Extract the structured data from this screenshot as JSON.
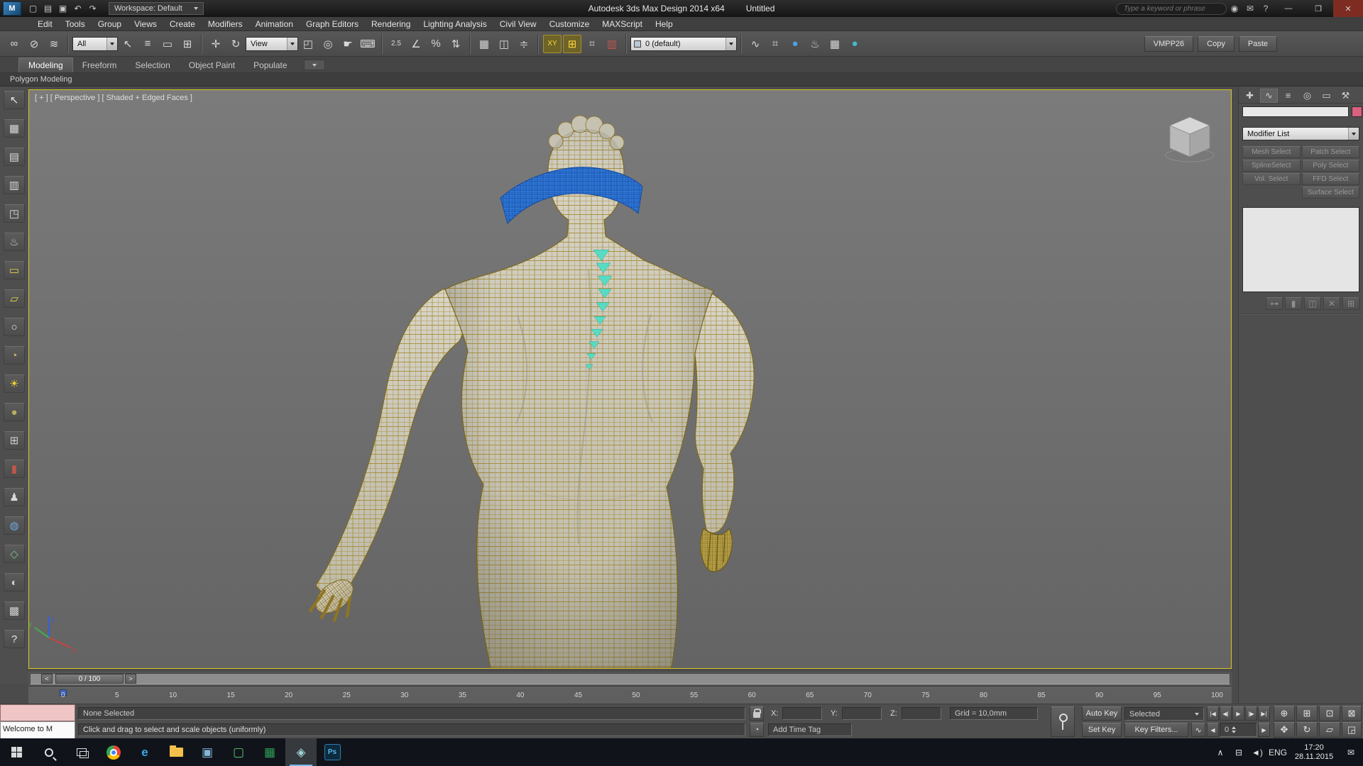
{
  "theme": {
    "viewport_border": "#d9c422",
    "selection_blue": "#2e79d8",
    "soft_selection_teal": "#5adfc6",
    "wireframe_yellow": "#a3882e",
    "accent_yellow": "#ffd43c"
  },
  "titlebar": {
    "logo_text": "M",
    "quick_icons": [
      "▢",
      "▤",
      "▣",
      "↶",
      "↷"
    ],
    "workspace_label": "Workspace: Default",
    "title": "Autodesk 3ds Max Design 2014 x64",
    "document": "Untitled",
    "search_placeholder": "Type a keyword or phrase",
    "help_icons": [
      "◉",
      "✉",
      "?"
    ],
    "window_buttons": [
      "—",
      "❐",
      "✕"
    ]
  },
  "menus": [
    "Edit",
    "Tools",
    "Group",
    "Views",
    "Create",
    "Modifiers",
    "Animation",
    "Graph Editors",
    "Rendering",
    "Lighting Analysis",
    "Civil View",
    "Customize",
    "MAXScript",
    "Help"
  ],
  "toolbar": {
    "link_icons": [
      "∞",
      "⊘",
      "≋"
    ],
    "filter_value": "All",
    "select_icons": [
      "↖",
      "≡",
      "▭",
      "⊞"
    ],
    "transform_icons": [
      "✛",
      "↻",
      "◰"
    ],
    "coord_value": "View",
    "pivot_icons": [
      "◎",
      "☛",
      "⌨"
    ],
    "snap_icons": [
      "2.5",
      "∠",
      "%",
      "⇅"
    ],
    "sel_set_icon": "▦",
    "mirror_icon": "◫",
    "align_icon": "≑",
    "constraint_label": "XY",
    "grid_icon": "⊞",
    "extra_icons": [
      "⌗",
      "▥"
    ],
    "layer_value": "0 (default)",
    "editor_icons": [
      "∿",
      "⌗",
      "●",
      "♨",
      "▦",
      "●"
    ],
    "buttons": [
      "VMPP26",
      "Copy",
      "Paste"
    ]
  },
  "ribbon": {
    "tabs": [
      "Modeling",
      "Freeform",
      "Selection",
      "Object Paint",
      "Populate"
    ],
    "panel": "Polygon Modeling"
  },
  "lefttools": {
    "icons": [
      {
        "g": "↖",
        "c": "#e8e8e8"
      },
      {
        "g": "▦",
        "c": "#d8d8d8"
      },
      {
        "g": "▤",
        "c": "#d8d8d8"
      },
      {
        "g": "▥",
        "c": "#d8d8d8"
      },
      {
        "g": "◳",
        "c": "#d8d8d8"
      },
      {
        "g": "♨",
        "c": "#cccccc"
      },
      {
        "g": "▭",
        "c": "#e7d24a"
      },
      {
        "g": "▱",
        "c": "#e7d24a"
      },
      {
        "g": "○",
        "c": "#e0e0e0"
      },
      {
        "g": "◔",
        "c": "#d8b86a"
      },
      {
        "g": "☀",
        "c": "#f2d431"
      },
      {
        "g": "●",
        "c": "#b9ad5f"
      },
      {
        "g": "⊞",
        "c": "#cfcfcf"
      },
      {
        "g": "▮",
        "c": "#c2564a"
      },
      {
        "g": "♟",
        "c": "#d8d8d8"
      },
      {
        "g": "◍",
        "c": "#6fa8dc"
      },
      {
        "g": "◇",
        "c": "#7cc47e"
      },
      {
        "g": "◐",
        "c": "#cfcfcf"
      },
      {
        "g": "▩",
        "c": "#cfcfcf"
      },
      {
        "g": "?",
        "c": "#e8e8e8"
      }
    ]
  },
  "viewport": {
    "label": "[ + ] [ Perspective ] [ Shaded + Edged Faces ]",
    "axes": {
      "x": "x",
      "y": "y",
      "z": "z"
    }
  },
  "command_panel": {
    "tab_icons": [
      "✚",
      "∿",
      "≡",
      "◎",
      "▭",
      "⚒"
    ],
    "name_value": "",
    "modifier_list": "Modifier List",
    "select_buttons": [
      "Mesh Select",
      "Patch Select",
      "SplineSelect",
      "Poly Select",
      "Vol. Select",
      "FFD Select",
      "",
      "Surface Select"
    ],
    "tool_icons": [
      "⊶",
      "▮",
      "◫",
      "✕",
      "⊞"
    ]
  },
  "timeline": {
    "prev": "<",
    "next": ">",
    "frame_label": "0 / 100",
    "ticks": [
      "0",
      "5",
      "10",
      "15",
      "20",
      "25",
      "30",
      "35",
      "40",
      "45",
      "50",
      "55",
      "60",
      "65",
      "70",
      "75",
      "80",
      "85",
      "90",
      "95",
      "100"
    ]
  },
  "status": {
    "listener_output": "Welcome to M",
    "selection": "None Selected",
    "coords": [
      {
        "label": "X:",
        "value": ""
      },
      {
        "label": "Y:",
        "value": ""
      },
      {
        "label": "Z:",
        "value": ""
      }
    ],
    "grid": "Grid = 10,0mm",
    "prompt": "Click and drag to select and scale objects (uniformly)",
    "tag_icon": "◔",
    "time_tag": "Add Time Tag",
    "auto_key": "Auto Key",
    "set_key": "Set Key",
    "key_mode": "Selected",
    "key_filters": "Key Filters...",
    "mode_icon": "∿",
    "transport": [
      "|◀",
      "◀|",
      "▶",
      "|▶",
      "▶|"
    ],
    "frame_prev": "◀",
    "frame_value": "0",
    "frame_next": "▶",
    "nav_icons": [
      "⊕",
      "⊞",
      "⊡",
      "⊠",
      "✥",
      "↻",
      "▱",
      "◲"
    ]
  },
  "taskbar": {
    "apps": [
      {
        "g": "",
        "c": "#ffffff"
      },
      {
        "g": "e",
        "c": "#3ba7e8"
      },
      {
        "g": "",
        "c": "#f3c14b"
      },
      {
        "g": "▣",
        "c": "#84b6d8"
      },
      {
        "g": "▢",
        "c": "#58c472"
      },
      {
        "g": "▦",
        "c": "#2f9e57"
      },
      {
        "g": "◈",
        "c": "#9fd4d4"
      },
      {
        "g": "Ps",
        "c": "#5ab3e8"
      }
    ],
    "tray": {
      "chevron": "∧",
      "network": "⊟",
      "volume": "◄)",
      "lang": "ENG",
      "time": "17:20",
      "date": "28.11.2015",
      "note": "✉"
    }
  }
}
